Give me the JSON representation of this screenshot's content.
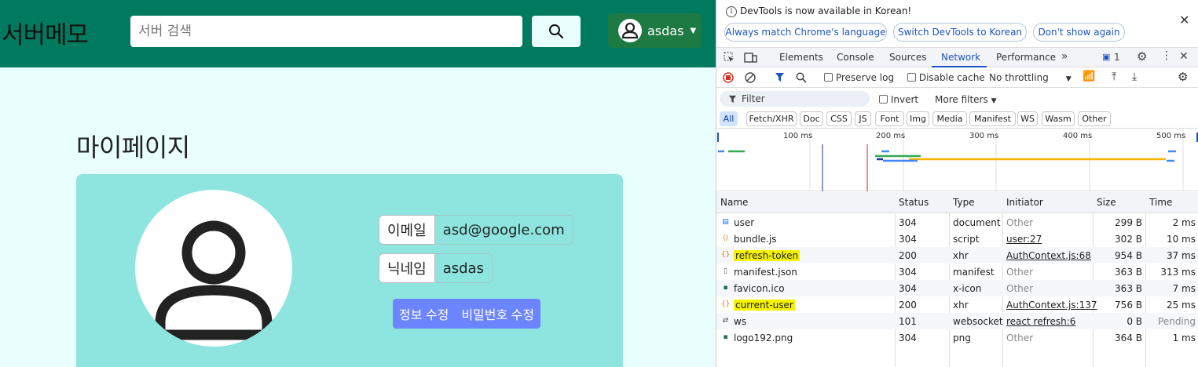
{
  "app": {
    "brand": "서버메모",
    "search_placeholder": "서버 검색",
    "user_name": "asdas",
    "page_title": "마이페이지",
    "email_label": "이메일",
    "email_value": "asd@google.com",
    "nickname_label": "닉네임",
    "nickname_value": "asdas",
    "edit_info_button": "정보 수정",
    "change_password_button": "비밀번호 수정",
    "colors": {
      "navbar": "#007a5e",
      "card": "#8ee5e0",
      "button": "#6c85ff",
      "background": "#e8fffd"
    }
  },
  "devtools": {
    "info_text": "DevTools is now available in Korean!",
    "lang_buttons": [
      "Always match Chrome's language",
      "Switch DevTools to Korean",
      "Don't show again"
    ],
    "tabs": [
      "Elements",
      "Console",
      "Sources",
      "Network",
      "Performance"
    ],
    "active_tab": "Network",
    "message_count": "1",
    "preserve_log": "Preserve log",
    "disable_cache": "Disable cache",
    "throttling": "No throttling",
    "filter_placeholder": "Filter",
    "invert": "Invert",
    "more_filters": "More filters",
    "type_filters": [
      "All",
      "Fetch/XHR",
      "Doc",
      "CSS",
      "JS",
      "Font",
      "Img",
      "Media",
      "Manifest",
      "WS",
      "Wasm",
      "Other"
    ],
    "timeline_ticks": [
      "100 ms",
      "200 ms",
      "300 ms",
      "400 ms",
      "500 ms"
    ],
    "columns": [
      "Name",
      "Status",
      "Type",
      "Initiator",
      "Size",
      "Time"
    ],
    "rows": [
      {
        "name": "user",
        "status": "304",
        "type": "document",
        "initiator": "Other",
        "size": "299 B",
        "time": "2 ms",
        "icon": "document-icon"
      },
      {
        "name": "bundle.js",
        "status": "304",
        "type": "script",
        "initiator": "user:27",
        "size": "302 B",
        "time": "10 ms",
        "icon": "script-icon"
      },
      {
        "name": "refresh-token",
        "status": "200",
        "type": "xhr",
        "initiator": "AuthContext.js:68",
        "size": "954 B",
        "time": "37 ms",
        "icon": "xhr-icon",
        "highlighted": true
      },
      {
        "name": "manifest.json",
        "status": "304",
        "type": "manifest",
        "initiator": "Other",
        "size": "363 B",
        "time": "313 ms",
        "icon": "file-icon"
      },
      {
        "name": "favicon.ico",
        "status": "304",
        "type": "x-icon",
        "initiator": "Other",
        "size": "363 B",
        "time": "7 ms",
        "icon": "image-icon"
      },
      {
        "name": "current-user",
        "status": "200",
        "type": "xhr",
        "initiator": "AuthContext.js:137",
        "size": "756 B",
        "time": "25 ms",
        "icon": "xhr-icon",
        "highlighted": true
      },
      {
        "name": "ws",
        "status": "101",
        "type": "websocket",
        "initiator": "react refresh:6",
        "size": "0 B",
        "time": "Pending",
        "icon": "websocket-icon"
      },
      {
        "name": "logo192.png",
        "status": "304",
        "type": "png",
        "initiator": "Other",
        "size": "364 B",
        "time": "1 ms",
        "icon": "image-icon"
      }
    ]
  }
}
